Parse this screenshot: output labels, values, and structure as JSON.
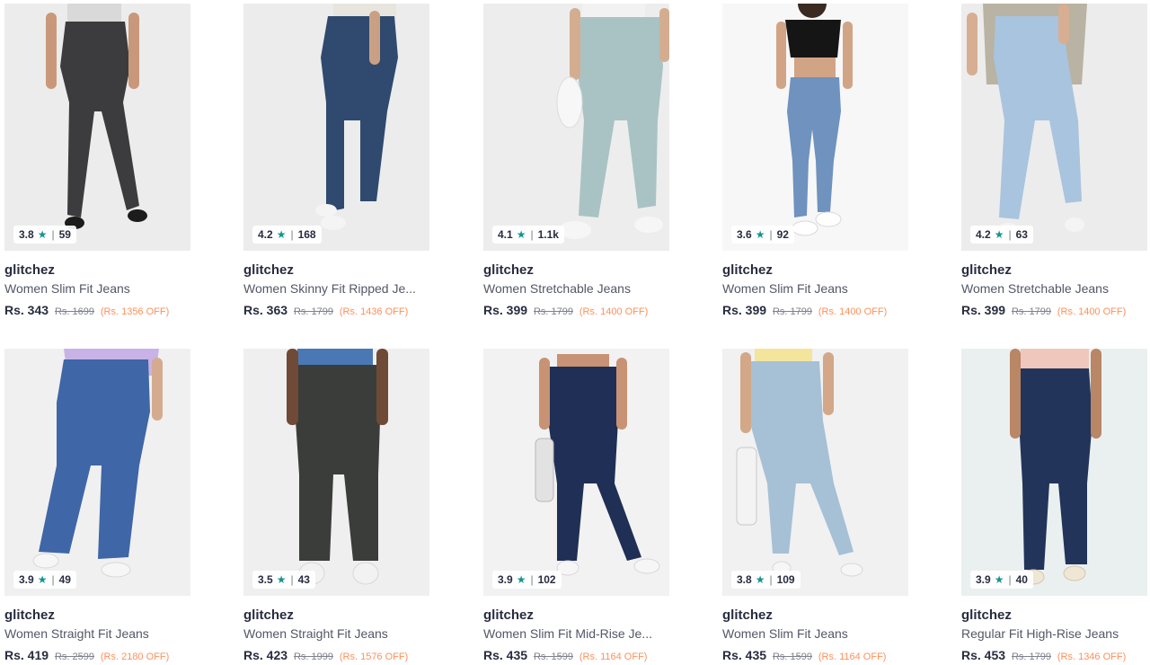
{
  "products": [
    {
      "brand": "glitchez",
      "name": "Women Slim Fit Jeans",
      "rating": "3.8",
      "count": "59",
      "price": "Rs. 343",
      "mrp": "Rs. 1699",
      "off": "(Rs. 1356 OFF)",
      "bg": "#ececec",
      "denim": "#3c3c3e",
      "top": "#d9d9d9",
      "skin": "#c9987a",
      "shoe": "#1c1c1c"
    },
    {
      "brand": "glitchez",
      "name": "Women Skinny Fit Ripped Je...",
      "rating": "4.2",
      "count": "168",
      "price": "Rs. 363",
      "mrp": "Rs. 1799",
      "off": "(Rs. 1436 OFF)",
      "bg": "#ececec",
      "denim": "#2f4a6e",
      "top": "#e8e5df",
      "skin": "#caa084",
      "shoe": "#f4f4f4"
    },
    {
      "brand": "glitchez",
      "name": "Women Stretchable Jeans",
      "rating": "4.1",
      "count": "1.1k",
      "price": "Rs. 399",
      "mrp": "Rs. 1799",
      "off": "(Rs. 1400 OFF)",
      "bg": "#ededed",
      "denim": "#a9c3c4",
      "top": "#f2f2f2",
      "skin": "#d4ad91",
      "shoe": "#f6f6f6"
    },
    {
      "brand": "glitchez",
      "name": "Women Slim Fit Jeans",
      "rating": "3.6",
      "count": "92",
      "price": "Rs. 399",
      "mrp": "Rs. 1799",
      "off": "(Rs. 1400 OFF)",
      "bg": "#f7f7f7",
      "denim": "#6f92be",
      "top": "#151515",
      "skin": "#d1a486",
      "shoe": "#ffffff"
    },
    {
      "brand": "glitchez",
      "name": "Women Stretchable Jeans",
      "rating": "4.2",
      "count": "63",
      "price": "Rs. 399",
      "mrp": "Rs. 1799",
      "off": "(Rs. 1400 OFF)",
      "bg": "#ececec",
      "denim": "#a9c4de",
      "top": "#b9b3a3",
      "skin": "#d7ae92",
      "shoe": "#f4f4f4"
    },
    {
      "brand": "glitchez",
      "name": "Women Straight Fit Jeans",
      "rating": "3.9",
      "count": "49",
      "price": "Rs. 419",
      "mrp": "Rs. 2599",
      "off": "(Rs. 2180 OFF)",
      "bg": "#f0f0f0",
      "denim": "#3f66a6",
      "top": "#c9b2e6",
      "skin": "#d4ab8f",
      "shoe": "#f6f6f6"
    },
    {
      "brand": "glitchez",
      "name": "Women Straight Fit Jeans",
      "rating": "3.5",
      "count": "43",
      "price": "Rs. 423",
      "mrp": "Rs. 1999",
      "off": "(Rs. 1576 OFF)",
      "bg": "#efefef",
      "denim": "#3b3d3a",
      "top": "#4a78b5",
      "skin": "#6f4a36",
      "shoe": "#f2f2f2"
    },
    {
      "brand": "glitchez",
      "name": "Women Slim Fit Mid-Rise Je...",
      "rating": "3.9",
      "count": "102",
      "price": "Rs. 435",
      "mrp": "Rs. 1599",
      "off": "(Rs. 1164 OFF)",
      "bg": "#f2f2f2",
      "denim": "#1f2f55",
      "top": "#f1f1f1",
      "skin": "#c89274",
      "shoe": "#f6f6f6"
    },
    {
      "brand": "glitchez",
      "name": "Women Slim Fit Jeans",
      "rating": "3.8",
      "count": "109",
      "price": "Rs. 435",
      "mrp": "Rs. 1599",
      "off": "(Rs. 1164 OFF)",
      "bg": "#f1f1f1",
      "denim": "#a6c0d6",
      "top": "#f3e59b",
      "skin": "#d2a888",
      "shoe": "#f6f6f6"
    },
    {
      "brand": "glitchez",
      "name": "Regular Fit High-Rise Jeans",
      "rating": "3.9",
      "count": "40",
      "price": "Rs. 453",
      "mrp": "Rs. 1799",
      "off": "(Rs. 1346 OFF)",
      "bg": "#eaf0f0",
      "denim": "#23345b",
      "top": "#efc7bc",
      "skin": "#b98666",
      "shoe": "#efe6d4"
    }
  ]
}
